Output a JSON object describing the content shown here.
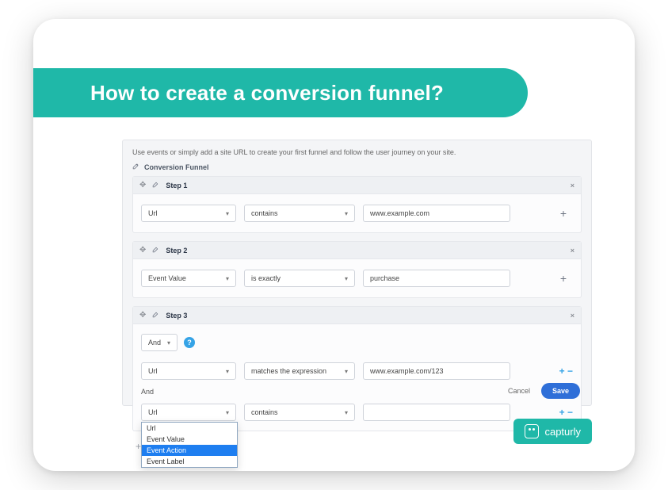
{
  "title": "How to create a conversion funnel?",
  "intro": "Use events or simply add a site URL to create your first funnel and follow the user journey on your site.",
  "funnel_name": "Conversion Funnel",
  "steps": [
    {
      "label": "Step 1",
      "rows": [
        {
          "type": "Url",
          "operator": "contains",
          "value": "www.example.com"
        }
      ]
    },
    {
      "label": "Step 2",
      "rows": [
        {
          "type": "Event Value",
          "operator": "is exactly",
          "value": "purchase"
        }
      ]
    },
    {
      "label": "Step 3",
      "logic": "And",
      "and_label": "And",
      "rows": [
        {
          "type": "Url",
          "operator": "matches the expression",
          "value": "www.example.com/123"
        },
        {
          "type": "Url",
          "operator": "contains",
          "value": ""
        }
      ]
    }
  ],
  "dropdown": {
    "options": [
      "Url",
      "Event Value",
      "Event Action",
      "Event Label"
    ],
    "selected": "Event Action"
  },
  "actions": {
    "cancel": "Cancel",
    "save": "Save"
  },
  "brand": "capturly"
}
